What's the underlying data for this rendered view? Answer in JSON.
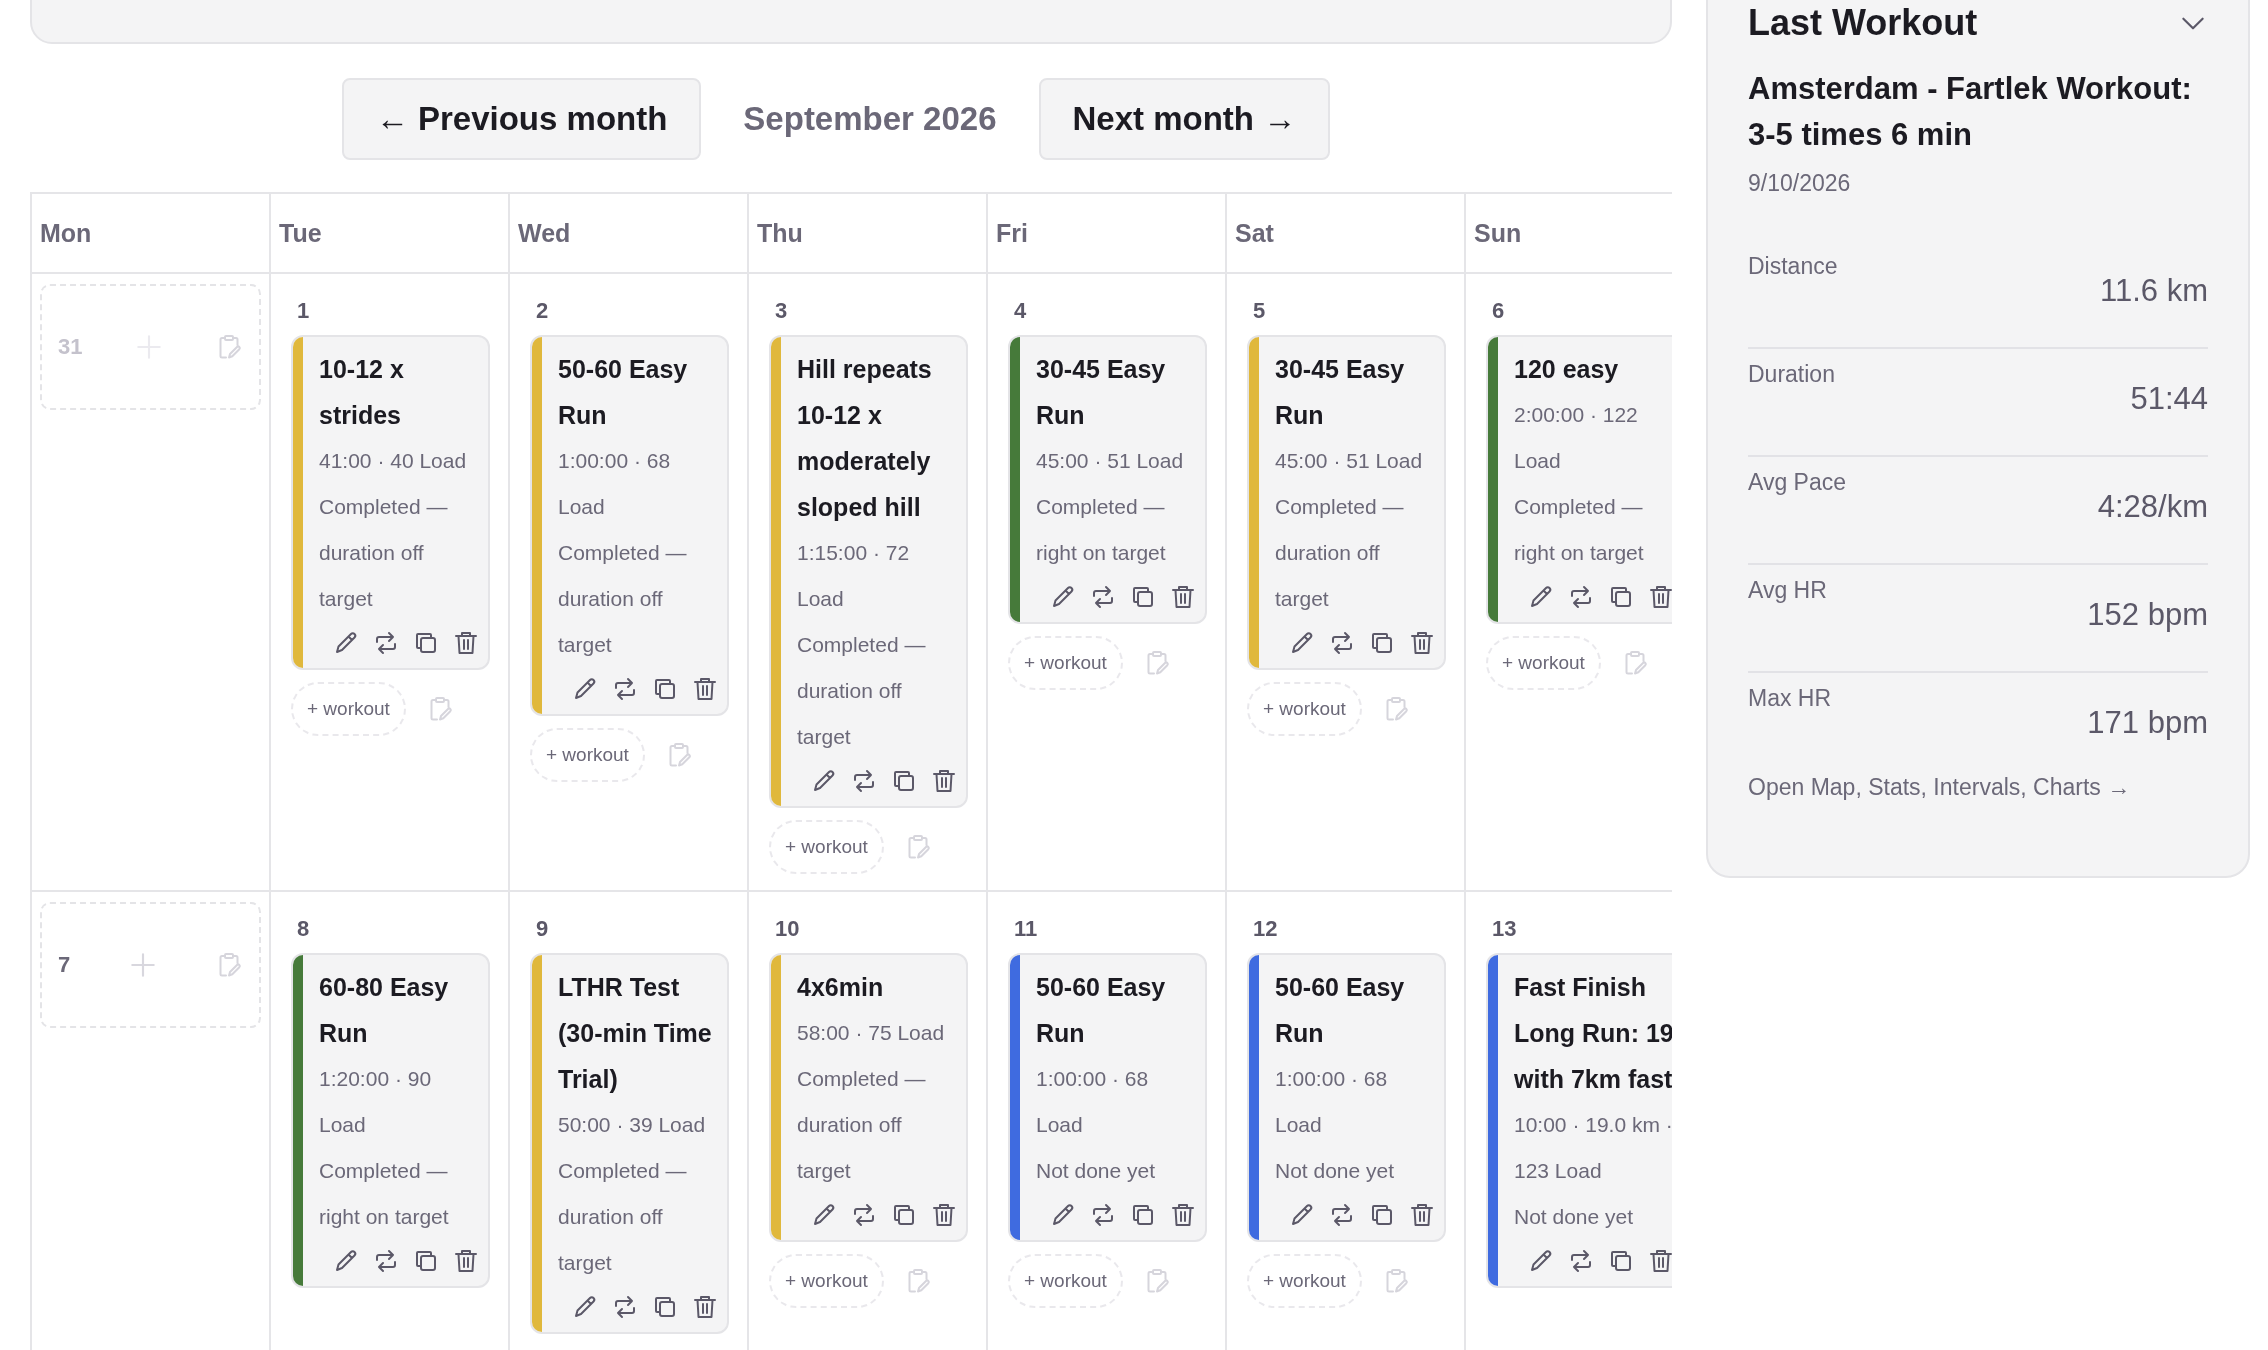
{
  "navigation": {
    "previous": "← Previous month",
    "month": "September 2026",
    "next": "Next month →"
  },
  "calendar": {
    "weekdays": [
      "Mon",
      "Tue",
      "Wed",
      "Thu",
      "Fri",
      "Sat",
      "Sun"
    ],
    "weeks": [
      {
        "days": [
          {
            "kind": "empty",
            "day": "31",
            "outside_month": true
          },
          {
            "kind": "planned",
            "day": "1",
            "workouts": [
              {
                "title": "10-12 x strides",
                "summary": "41:00 · 40 Load",
                "status": "Completed — duration off target",
                "color": "#e0b83c"
              }
            ],
            "add_label": "+ workout"
          },
          {
            "kind": "planned",
            "day": "2",
            "workouts": [
              {
                "title": "50-60 Easy Run",
                "summary": "1:00:00 · 68 Load",
                "status": "Completed — duration off target",
                "color": "#e0b83c"
              }
            ],
            "add_label": "+ workout"
          },
          {
            "kind": "planned",
            "day": "3",
            "workouts": [
              {
                "title": "Hill repeats 10-12 x moderately sloped hill",
                "summary": "1:15:00 · 72 Load",
                "status": "Completed — duration off target",
                "color": "#e0b83c"
              }
            ],
            "add_label": "+ workout"
          },
          {
            "kind": "planned",
            "day": "4",
            "workouts": [
              {
                "title": "30-45 Easy Run",
                "summary": "45:00 · 51 Load",
                "status": "Completed — right on target",
                "color": "#467a3a"
              }
            ],
            "add_label": "+ workout"
          },
          {
            "kind": "planned",
            "day": "5",
            "workouts": [
              {
                "title": "30-45 Easy Run",
                "summary": "45:00 · 51 Load",
                "status": "Completed — duration off target",
                "color": "#e0b83c"
              }
            ],
            "add_label": "+ workout"
          },
          {
            "kind": "planned",
            "day": "6",
            "workouts": [
              {
                "title": "120 easy",
                "summary": "2:00:00 · 122 Load",
                "status": "Completed — right on target",
                "color": "#467a3a"
              }
            ],
            "add_label": "+ workout"
          }
        ]
      },
      {
        "days": [
          {
            "kind": "empty",
            "day": "7",
            "outside_month": false
          },
          {
            "kind": "planned",
            "day": "8",
            "workouts": [
              {
                "title": "60-80 Easy Run",
                "summary": "1:20:00 · 90 Load",
                "status": "Completed — right on target",
                "color": "#467a3a"
              }
            ]
          },
          {
            "kind": "planned",
            "day": "9",
            "workouts": [
              {
                "title": "LTHR Test (30-min Time Trial)",
                "summary": "50:00 · 39 Load",
                "status": "Completed — duration off target",
                "color": "#e0b83c"
              }
            ]
          },
          {
            "kind": "planned",
            "day": "10",
            "workouts": [
              {
                "title": "4x6min",
                "summary": "58:00 · 75 Load",
                "status": "Completed — duration off target",
                "color": "#e0b83c"
              }
            ],
            "add_label": "+ workout"
          },
          {
            "kind": "planned",
            "day": "11",
            "workouts": [
              {
                "title": "50-60 Easy Run",
                "summary": "1:00:00 · 68 Load",
                "status": "Not done yet",
                "color": "#3f6be0"
              }
            ],
            "add_label": "+ workout"
          },
          {
            "kind": "planned",
            "day": "12",
            "workouts": [
              {
                "title": "50-60 Easy Run",
                "summary": "1:00:00 · 68 Load",
                "status": "Not done yet",
                "color": "#3f6be0"
              }
            ],
            "add_label": "+ workout"
          },
          {
            "kind": "planned",
            "day": "13",
            "workouts": [
              {
                "title": "Fast Finish Long Run: 19 with 7km fast",
                "summary": "10:00 · 19.0 km · 123 Load",
                "status": "Not done yet",
                "color": "#3f6be0"
              }
            ]
          }
        ]
      }
    ]
  },
  "last_workout": {
    "heading": "Last Workout",
    "name": "Amsterdam - Fartlek Workout: 3-5 times 6 min",
    "date": "9/10/2026",
    "stats": [
      {
        "label": "Distance",
        "value": "11.6 km"
      },
      {
        "label": "Duration",
        "value": "51:44"
      },
      {
        "label": "Avg Pace",
        "value": "4:28/km"
      },
      {
        "label": "Avg HR",
        "value": "152 bpm"
      },
      {
        "label": "Max HR",
        "value": "171 bpm"
      }
    ],
    "link": "Open Map, Stats, Intervals, Charts →"
  }
}
